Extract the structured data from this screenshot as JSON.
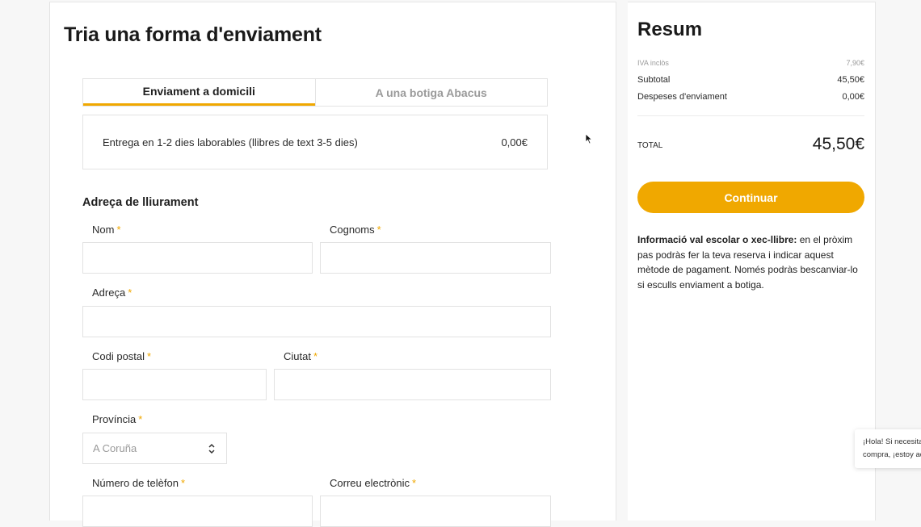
{
  "main": {
    "title": "Tria una forma d'enviament",
    "tabs": [
      {
        "label": "Enviament a domicili",
        "active": true
      },
      {
        "label": "A una botiga Abacus",
        "active": false
      }
    ],
    "shipping_option": {
      "label": "Entrega en 1-2 dies laborables (llibres de text 3-5 dies)",
      "price": "0,00€"
    },
    "address_section_title": "Adreça de lliurament",
    "required_marker": "*",
    "fields": {
      "nom": "Nom",
      "cognoms": "Cognoms",
      "adreca": "Adreça",
      "codi_postal": "Codi postal",
      "ciutat": "Ciutat",
      "provincia": "Província",
      "provincia_value": "A Coruña",
      "telefon": "Número de telèfon",
      "correu": "Correu electrònic"
    }
  },
  "summary": {
    "title": "Resum",
    "iva_label": "IVA inclòs",
    "iva_value": "7,90€",
    "subtotal_label": "Subtotal",
    "subtotal_value": "45,50€",
    "shipping_label": "Despeses d'enviament",
    "shipping_value": "0,00€",
    "total_label": "TOTAL",
    "total_value": "45,50€",
    "continue_label": "Continuar",
    "info_bold": "Informació val escolar o xec-llibre:",
    "info_text": " en el pròxim pas podràs fer la teva reserva i indicar aquest mètode de pagament. Només podràs bescanviar-lo si esculls enviament a botiga."
  },
  "chat": {
    "line1": "¡Hola! Si necesitas",
    "line2": "compra, ¡estoy aquí"
  },
  "colors": {
    "accent": "#f0a800",
    "text": "#1e1e1e",
    "muted": "#9a9a9a",
    "border": "#e2e2e2"
  }
}
